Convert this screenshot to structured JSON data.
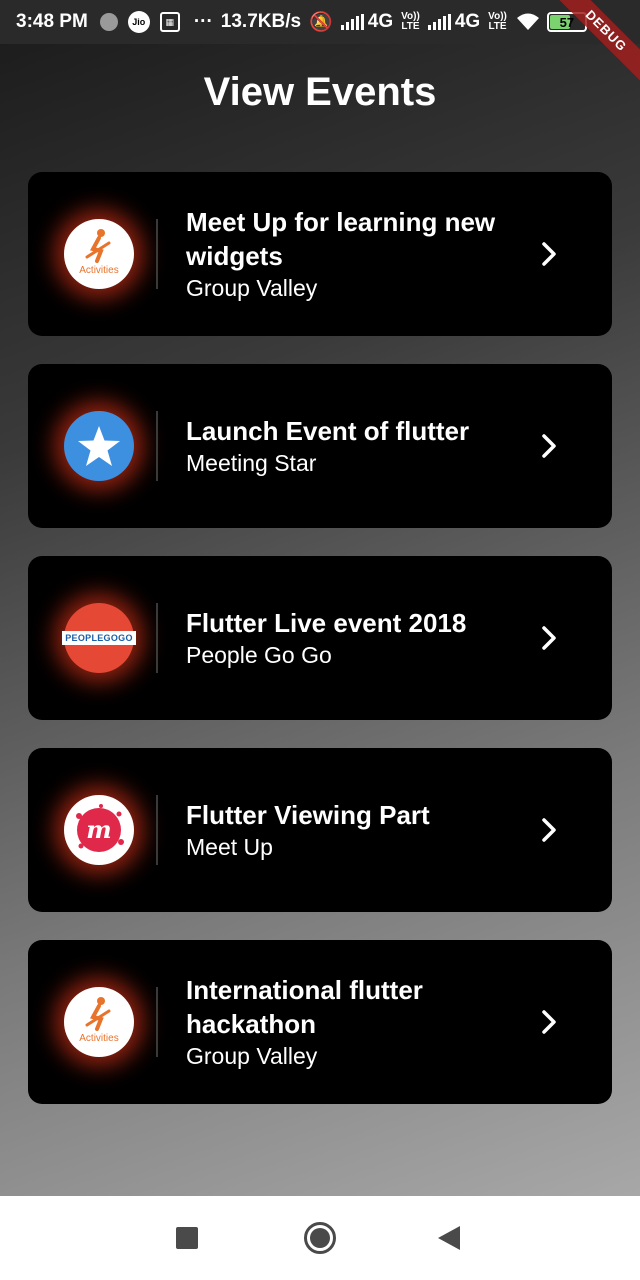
{
  "status_bar": {
    "time": "3:48 PM",
    "jio": "Jio",
    "dots": "···",
    "speed": "13.7KB/s",
    "net1": "4G",
    "volte1_top": "Vo))",
    "volte1_bottom": "LTE",
    "net2": "4G",
    "volte2_top": "Vo))",
    "volte2_bottom": "LTE",
    "battery": "57"
  },
  "debug_banner": "DEBUG",
  "page": {
    "title": "View Events"
  },
  "events": [
    {
      "title": "Meet Up  for learning new widgets",
      "organizer": "Group Valley",
      "logo": "activities-logo",
      "logo_text": "Activities"
    },
    {
      "title": "Launch Event of flutter",
      "organizer": "Meeting Star",
      "logo": "star-logo"
    },
    {
      "title": "Flutter Live event 2018",
      "organizer": "People Go Go",
      "logo": "peoplegogo-logo",
      "logo_text": "PEOPLEGOGO"
    },
    {
      "title": "Flutter Viewing Part",
      "organizer": "Meet Up",
      "logo": "meetup-logo",
      "logo_text": "m"
    },
    {
      "title": "International flutter hackathon",
      "organizer": "Group Valley",
      "logo": "activities-logo",
      "logo_text": "Activities"
    }
  ],
  "colors": {
    "card_bg": "#000000",
    "glow": "#ff3c1e",
    "star_blue": "#3d8fe0",
    "meetup_red": "#e0284a",
    "activities_orange": "#e8742c"
  },
  "nav_bar": {
    "recents": "square-icon",
    "home": "circle-icon",
    "back": "triangle-back-icon"
  }
}
